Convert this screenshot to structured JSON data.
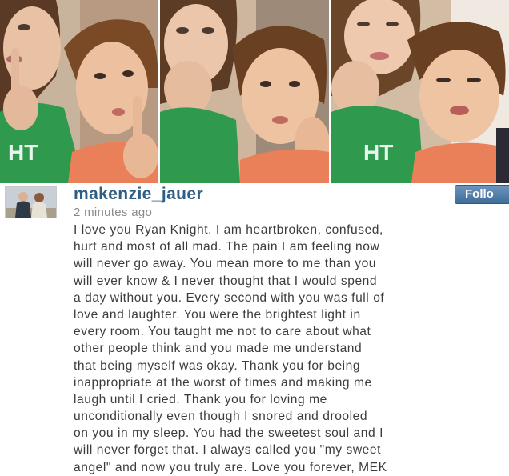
{
  "post": {
    "username": "makenzie_jauer",
    "timestamp": "2 minutes ago",
    "follow_label": "Follo",
    "caption_lines": [
      "I love you Ryan Knight. I am heartbroken, confused,",
      "hurt and most of all mad. The pain I am feeling now",
      "will never go away. You mean more to me than you",
      "will ever know & I never thought that I would spend",
      "a day without you. Every second with you was full of",
      "love and laughter. You were the brightest light in",
      "every room. You taught me not to care about what",
      "other people think and you made me understand",
      "that being myself was okay. Thank you for being",
      "inappropriate at the worst of times and making me",
      "laugh until I cried. Thank you for loving me",
      "unconditionally even though I snored and drooled",
      "on you in my sleep. You had the sweetest soul and I",
      "will never forget that. I always called you \"my sweet",
      "angel\" and now you truly are. Love you forever, MEK"
    ]
  },
  "photos": [
    {
      "shirt_text": "HT"
    },
    {
      "shirt_text": ""
    },
    {
      "shirt_text": "HT"
    }
  ],
  "colors": {
    "username": "#2e5e86",
    "timestamp": "#8a8a8a",
    "caption": "#3c3c3c",
    "follow_button": "#4a78a4",
    "green_shirt": "#2f9a4e",
    "orange_shirt": "#e9805a"
  }
}
